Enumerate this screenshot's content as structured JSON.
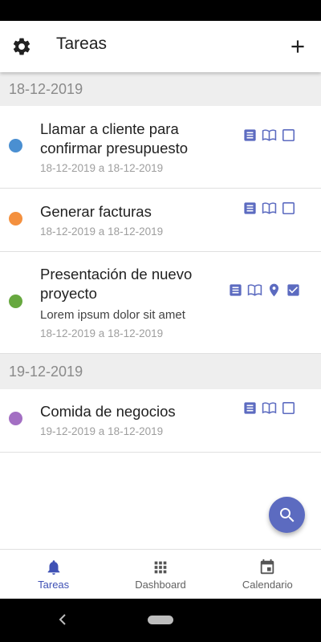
{
  "app_bar": {
    "title": "Tareas",
    "settings_icon": "gear-icon",
    "add_icon": "plus-icon"
  },
  "colors": {
    "accent": "#3f51b5",
    "fab": "#5c6bc0",
    "icon": "#5c6bc0"
  },
  "groups": [
    {
      "date": "18-12-2019",
      "tasks": [
        {
          "title_lines": [
            "Llamar a cliente para",
            "confirmar presupuesto"
          ],
          "description": "",
          "dates": "18-12-2019 a 18-12-2019",
          "color": "#4a8fd1",
          "icons": [
            "notes-icon",
            "book-icon",
            "checkbox-empty-icon"
          ]
        },
        {
          "title_lines": [
            "Generar facturas"
          ],
          "description": "",
          "dates": "18-12-2019 a 18-12-2019",
          "color": "#f4903e",
          "icons": [
            "notes-icon",
            "book-icon",
            "checkbox-empty-icon"
          ]
        },
        {
          "title_lines": [
            "Presentación de nuevo",
            "proyecto"
          ],
          "description": "Lorem ipsum dolor sit amet",
          "dates": "18-12-2019 a 18-12-2019",
          "color": "#67a83f",
          "icons": [
            "notes-icon",
            "book-icon",
            "location-pin-icon",
            "checkbox-checked-icon"
          ]
        }
      ]
    },
    {
      "date": "19-12-2019",
      "tasks": [
        {
          "title_lines": [
            "Comida de negocios"
          ],
          "description": "",
          "dates": "19-12-2019 a 18-12-2019",
          "color": "#a36fc3",
          "icons": [
            "notes-icon",
            "book-icon",
            "checkbox-empty-icon"
          ]
        }
      ]
    }
  ],
  "fab": {
    "icon": "search-icon"
  },
  "bottom_nav": [
    {
      "label": "Tareas",
      "icon": "bell-icon",
      "active": true
    },
    {
      "label": "Dashboard",
      "icon": "grid-icon",
      "active": false
    },
    {
      "label": "Calendario",
      "icon": "calendar-icon",
      "active": false
    }
  ]
}
